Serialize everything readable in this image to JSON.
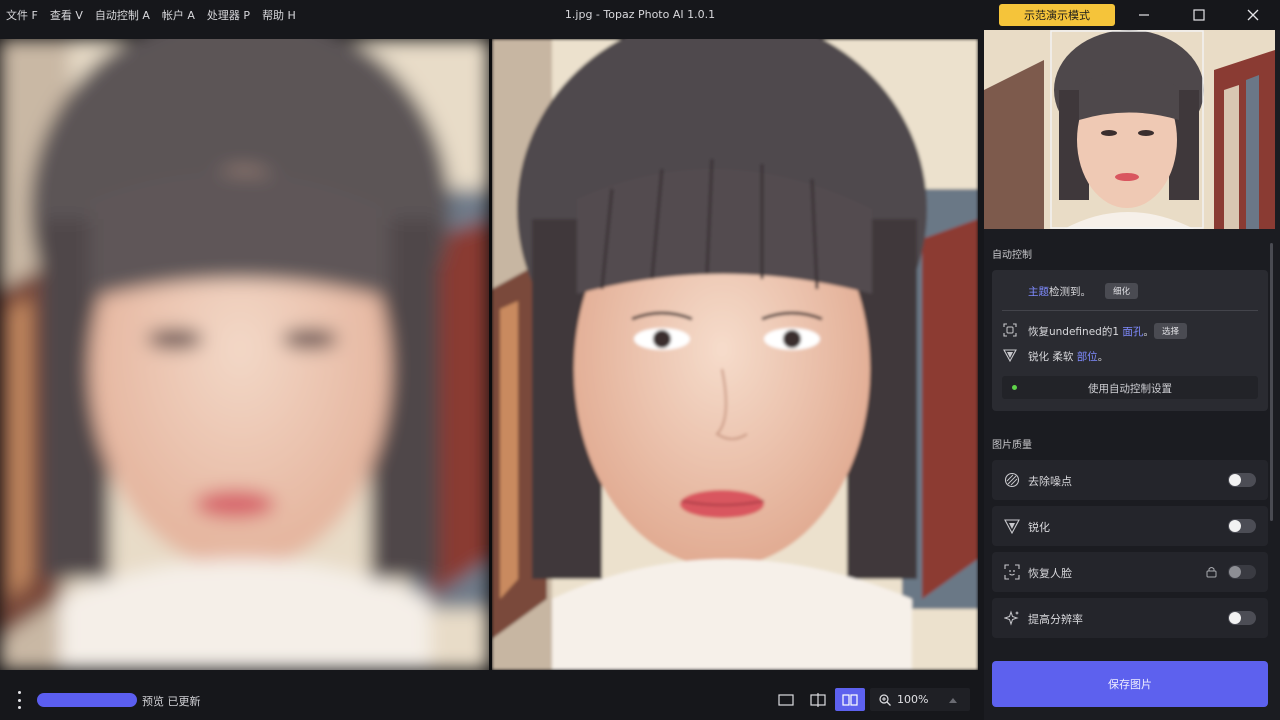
{
  "menu": [
    "文件 F",
    "查看 V",
    "自动控制 A",
    "帐户 A",
    "处理器 P",
    "帮助 H"
  ],
  "window_title": "1.jpg - Topaz Photo AI 1.0.1",
  "demo_mode_label": "示范演示模式",
  "auto_control": {
    "title": "自动控制",
    "subject_detect": "主题",
    "subject_detect_rest": "检测到。",
    "subject_chip": "细化",
    "face_prefix": "恢复undefined的1 ",
    "face_link": "面孔",
    "face_suffix": "。",
    "face_chip": "选择",
    "sharpen_prefix": "锐化 柔软 ",
    "sharpen_link": "部位",
    "sharpen_suffix": "。",
    "use_button": "使用自动控制设置"
  },
  "quality": {
    "title": "图片质量",
    "items": [
      {
        "label": "去除噪点",
        "icon": "denoise-icon",
        "enabled": false
      },
      {
        "label": "锐化",
        "icon": "sharpen-icon",
        "enabled": false
      },
      {
        "label": "恢复人脸",
        "icon": "face-recovery-icon",
        "enabled": false,
        "locked": true
      },
      {
        "label": "提高分辨率",
        "icon": "upscale-icon",
        "enabled": false
      }
    ]
  },
  "save_label": "保存图片",
  "status": {
    "progress": 1.0,
    "text": "预览 已更新"
  },
  "zoom": "100%",
  "colors": {
    "accent": "#5d61ee",
    "demo": "#f5c43a",
    "link": "#7f8bff"
  }
}
